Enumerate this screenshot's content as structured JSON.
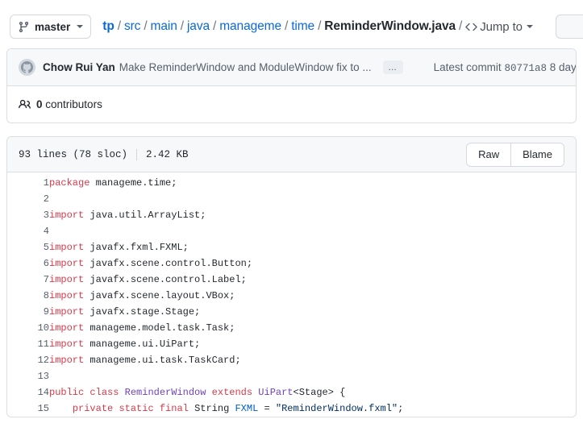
{
  "topbar": {
    "branch_label": "master",
    "branch_icon": "git-branch-icon",
    "breadcrumb": [
      {
        "label": "tp",
        "kind": "repo"
      },
      {
        "label": "src",
        "kind": "dir"
      },
      {
        "label": "main",
        "kind": "dir"
      },
      {
        "label": "java",
        "kind": "dir"
      },
      {
        "label": "manageme",
        "kind": "dir"
      },
      {
        "label": "time",
        "kind": "dir"
      },
      {
        "label": "ReminderWindow.java",
        "kind": "file"
      }
    ],
    "separator": "/",
    "jump_to_label": "Jump to",
    "jump_to_icon": "code-brackets-icon"
  },
  "commit": {
    "avatar_icon": "github-avatar-icon",
    "author": "Chow Rui Yan",
    "message": "Make ReminderWindow and ModuleWindow fix to ...",
    "expand_label": "…",
    "latest_commit_prefix": "Latest commit",
    "sha": "80771a8",
    "age": "8 day"
  },
  "contributors": {
    "icon": "people-icon",
    "count": "0",
    "label": "contributors"
  },
  "file": {
    "lines_info": "93 lines (78 sloc)",
    "size": "2.42 KB",
    "raw_label": "Raw",
    "blame_label": "Blame"
  },
  "code": {
    "lines": [
      {
        "n": "1",
        "tokens": [
          {
            "t": "package",
            "c": "k"
          },
          {
            "t": " manageme.time;",
            "c": ""
          }
        ]
      },
      {
        "n": "2",
        "tokens": []
      },
      {
        "n": "3",
        "tokens": [
          {
            "t": "import",
            "c": "k"
          },
          {
            "t": " java.util.ArrayList;",
            "c": ""
          }
        ]
      },
      {
        "n": "4",
        "tokens": []
      },
      {
        "n": "5",
        "tokens": [
          {
            "t": "import",
            "c": "k"
          },
          {
            "t": " javafx.fxml.FXML;",
            "c": ""
          }
        ]
      },
      {
        "n": "6",
        "tokens": [
          {
            "t": "import",
            "c": "k"
          },
          {
            "t": " javafx.scene.control.Button;",
            "c": ""
          }
        ]
      },
      {
        "n": "7",
        "tokens": [
          {
            "t": "import",
            "c": "k"
          },
          {
            "t": " javafx.scene.control.Label;",
            "c": ""
          }
        ]
      },
      {
        "n": "8",
        "tokens": [
          {
            "t": "import",
            "c": "k"
          },
          {
            "t": " javafx.scene.layout.VBox;",
            "c": ""
          }
        ]
      },
      {
        "n": "9",
        "tokens": [
          {
            "t": "import",
            "c": "k"
          },
          {
            "t": " javafx.stage.Stage;",
            "c": ""
          }
        ]
      },
      {
        "n": "10",
        "tokens": [
          {
            "t": "import",
            "c": "k"
          },
          {
            "t": " manageme.model.task.Task;",
            "c": ""
          }
        ]
      },
      {
        "n": "11",
        "tokens": [
          {
            "t": "import",
            "c": "k"
          },
          {
            "t": " manageme.ui.UiPart;",
            "c": ""
          }
        ]
      },
      {
        "n": "12",
        "tokens": [
          {
            "t": "import",
            "c": "k"
          },
          {
            "t": " manageme.ui.task.TaskCard;",
            "c": ""
          }
        ]
      },
      {
        "n": "13",
        "tokens": []
      },
      {
        "n": "14",
        "tokens": [
          {
            "t": "public",
            "c": "k"
          },
          {
            "t": " ",
            "c": ""
          },
          {
            "t": "class",
            "c": "k"
          },
          {
            "t": " ",
            "c": ""
          },
          {
            "t": "ReminderWindow",
            "c": "t"
          },
          {
            "t": " ",
            "c": ""
          },
          {
            "t": "extends",
            "c": "k"
          },
          {
            "t": " ",
            "c": ""
          },
          {
            "t": "UiPart",
            "c": "t"
          },
          {
            "t": "<Stage> {",
            "c": ""
          }
        ]
      },
      {
        "n": "15",
        "tokens": [
          {
            "t": "    ",
            "c": ""
          },
          {
            "t": "private",
            "c": "k"
          },
          {
            "t": " ",
            "c": ""
          },
          {
            "t": "static",
            "c": "k"
          },
          {
            "t": " ",
            "c": ""
          },
          {
            "t": "final",
            "c": "k"
          },
          {
            "t": " String ",
            "c": ""
          },
          {
            "t": "FXML",
            "c": "c"
          },
          {
            "t": " = ",
            "c": ""
          },
          {
            "t": "\"ReminderWindow.fxml\"",
            "c": "s"
          },
          {
            "t": ";",
            "c": ""
          }
        ]
      }
    ]
  }
}
